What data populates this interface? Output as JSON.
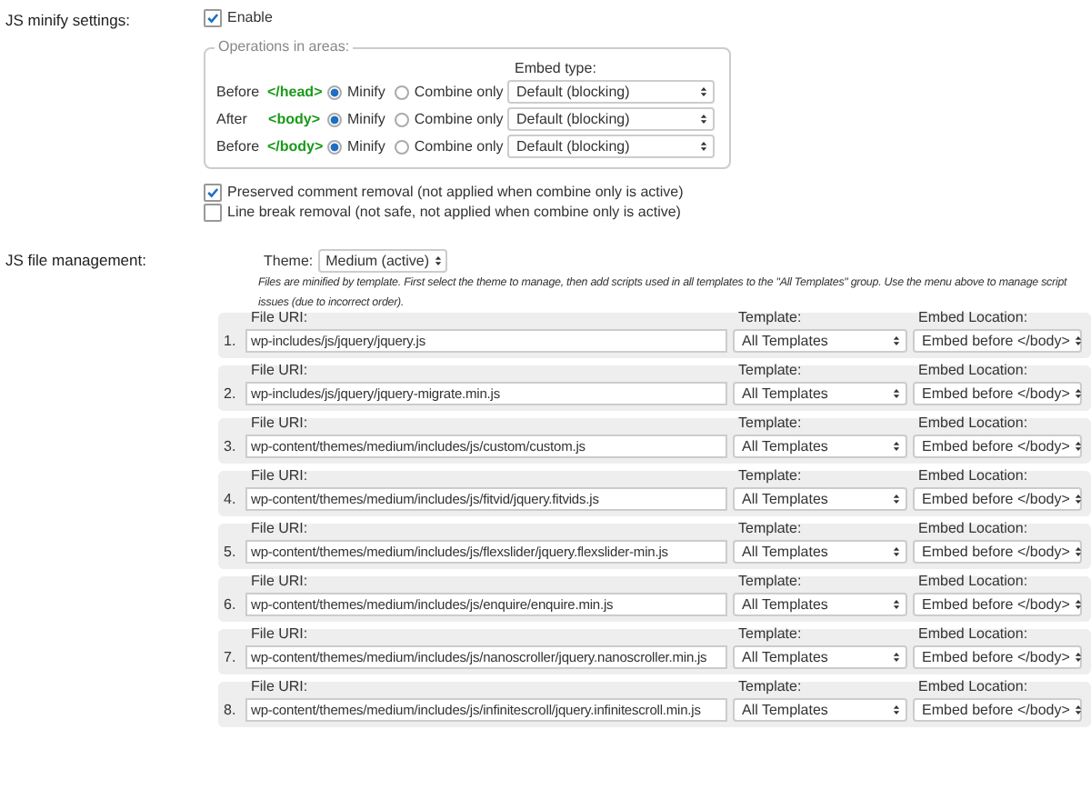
{
  "minify_settings": {
    "label": "JS minify settings:",
    "enable": {
      "label": "Enable",
      "checked": true
    },
    "operations": {
      "legend": "Operations in areas:",
      "embed_type_header": "Embed type:",
      "areas": [
        {
          "position": "Before",
          "tag": "</head>",
          "options": [
            {
              "label": "Minify",
              "selected": true
            },
            {
              "label": "Combine only",
              "selected": false
            }
          ],
          "embed_type": "Default (blocking)"
        },
        {
          "position": "After",
          "tag": "<body>",
          "options": [
            {
              "label": "Minify",
              "selected": true
            },
            {
              "label": "Combine only",
              "selected": false
            }
          ],
          "embed_type": "Default (blocking)"
        },
        {
          "position": "Before",
          "tag": "</body>",
          "options": [
            {
              "label": "Minify",
              "selected": true
            },
            {
              "label": "Combine only",
              "selected": false
            }
          ],
          "embed_type": "Default (blocking)"
        }
      ]
    },
    "options": [
      {
        "label": "Preserved comment removal (not applied when combine only is active)",
        "checked": true
      },
      {
        "label": "Line break removal (not safe, not applied when combine only is active)",
        "checked": false
      }
    ]
  },
  "file_management": {
    "label": "JS file management:",
    "theme_label": "Theme:",
    "theme": "Medium (active)",
    "description_lines": [
      "Files are minified by template. First select the theme to manage, then add scripts used in all templates to the \"All Templates\" group. Use the menu above to manage script",
      "issues (due to incorrect order)."
    ],
    "files": [
      {
        "number": "1.",
        "file_uri_label": "File URI:",
        "uri": "wp-includes/js/jquery/jquery.js",
        "template_label": "Template:",
        "template": "All Templates",
        "embed_location_label": "Embed Location:",
        "embed_location": "Embed before </body>"
      },
      {
        "number": "2.",
        "file_uri_label": "File URI:",
        "uri": "wp-includes/js/jquery/jquery-migrate.min.js",
        "template_label": "Template:",
        "template": "All Templates",
        "embed_location_label": "Embed Location:",
        "embed_location": "Embed before </body>"
      },
      {
        "number": "3.",
        "file_uri_label": "File URI:",
        "uri": "wp-content/themes/medium/includes/js/custom/custom.js",
        "template_label": "Template:",
        "template": "All Templates",
        "embed_location_label": "Embed Location:",
        "embed_location": "Embed before </body>"
      },
      {
        "number": "4.",
        "file_uri_label": "File URI:",
        "uri": "wp-content/themes/medium/includes/js/fitvid/jquery.fitvids.js",
        "template_label": "Template:",
        "template": "All Templates",
        "embed_location_label": "Embed Location:",
        "embed_location": "Embed before </body>"
      },
      {
        "number": "5.",
        "file_uri_label": "File URI:",
        "uri": "wp-content/themes/medium/includes/js/flexslider/jquery.flexslider-min.js",
        "template_label": "Template:",
        "template": "All Templates",
        "embed_location_label": "Embed Location:",
        "embed_location": "Embed before </body>"
      },
      {
        "number": "6.",
        "file_uri_label": "File URI:",
        "uri": "wp-content/themes/medium/includes/js/enquire/enquire.min.js",
        "template_label": "Template:",
        "template": "All Templates",
        "embed_location_label": "Embed Location:",
        "embed_location": "Embed before </body>"
      },
      {
        "number": "7.",
        "file_uri_label": "File URI:",
        "uri": "wp-content/themes/medium/includes/js/nanoscroller/jquery.nanoscroller.min.js",
        "template_label": "Template:",
        "template": "All Templates",
        "embed_location_label": "Embed Location:",
        "embed_location": "Embed before </body>"
      },
      {
        "number": "8.",
        "file_uri_label": "File URI:",
        "uri": "wp-content/themes/medium/includes/js/infinitescroll/jquery.infinitescroll.min.js",
        "template_label": "Template:",
        "template": "All Templates",
        "embed_location_label": "Embed Location:",
        "embed_location": "Embed before </body>"
      }
    ]
  }
}
